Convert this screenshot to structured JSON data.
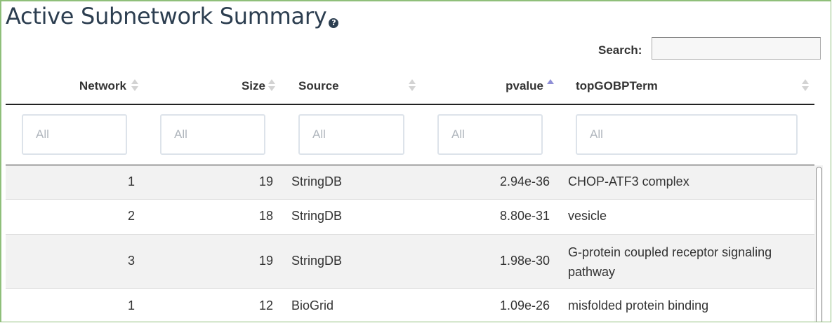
{
  "title": "Active Subnetwork Summary",
  "help_icon": "question-circle-icon",
  "search": {
    "label": "Search:",
    "value": "",
    "placeholder": ""
  },
  "columns": [
    {
      "label": "Network",
      "sort": "none"
    },
    {
      "label": "Size",
      "sort": "none"
    },
    {
      "label": "Source",
      "sort": "none"
    },
    {
      "label": "pvalue",
      "sort": "ascending"
    },
    {
      "label": "topGOBPTerm",
      "sort": "none"
    }
  ],
  "filters": [
    {
      "placeholder": "All",
      "value": ""
    },
    {
      "placeholder": "All",
      "value": ""
    },
    {
      "placeholder": "All",
      "value": ""
    },
    {
      "placeholder": "All",
      "value": ""
    },
    {
      "placeholder": "All",
      "value": ""
    }
  ],
  "rows": [
    {
      "network": "1",
      "size": "19",
      "source": "StringDB",
      "pvalue": "2.94e-36",
      "term": "CHOP-ATF3 complex"
    },
    {
      "network": "2",
      "size": "18",
      "source": "StringDB",
      "pvalue": "8.80e-31",
      "term": "vesicle"
    },
    {
      "network": "3",
      "size": "19",
      "source": "StringDB",
      "pvalue": "1.98e-30",
      "term": "G-protein coupled receptor signaling pathway"
    },
    {
      "network": "1",
      "size": "12",
      "source": "BioGrid",
      "pvalue": "1.09e-26",
      "term": "misfolded protein binding"
    }
  ],
  "colors": {
    "title": "#2c3e50",
    "frame_border": "#8fbf7a",
    "sort_active": "#8f8fd6",
    "sort_inactive": "#d3d3d3",
    "row_stripe": "#f2f2f2"
  }
}
